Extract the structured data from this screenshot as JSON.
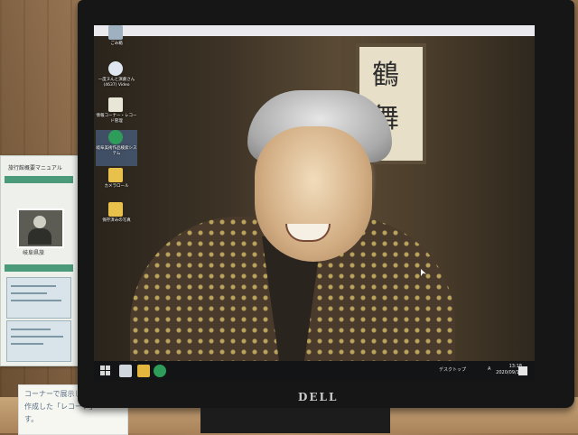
{
  "pamphlet": {
    "title": "旅行館概要マニュアル",
    "name": "岐阜県旅"
  },
  "sign": {
    "line1": "コーナーで展示し",
    "line2": "作成した「レコード」",
    "line3": "す。"
  },
  "monitor": {
    "brand": "DELL"
  },
  "desktop": {
    "background_sign": [
      "鶴",
      "舞"
    ],
    "icons": [
      {
        "label": "ごみ箱",
        "icon": "recycle-bin-icon",
        "color": "#9fb0c0"
      },
      {
        "label": "一度ヌんと演劇さん (4637) Video",
        "icon": "video-file-icon",
        "color": "#dfe8f0"
      },
      {
        "label": "情報コーナー・レコード管理",
        "icon": "document-icon",
        "color": "#e8e6d6"
      },
      {
        "label": "岐阜美術作品検索システム",
        "icon": "app-icon",
        "color": "#2f9d5a"
      },
      {
        "label": "カメラロール",
        "icon": "folder-icon",
        "color": "#e8c04c"
      },
      {
        "label": "保存済みの写真",
        "icon": "folder-icon",
        "color": "#e8c04c"
      }
    ]
  },
  "taskbar": {
    "tray_label": "デスクトップ",
    "input_indicator": "A",
    "time": "13:18",
    "date": "2020/09/16"
  }
}
